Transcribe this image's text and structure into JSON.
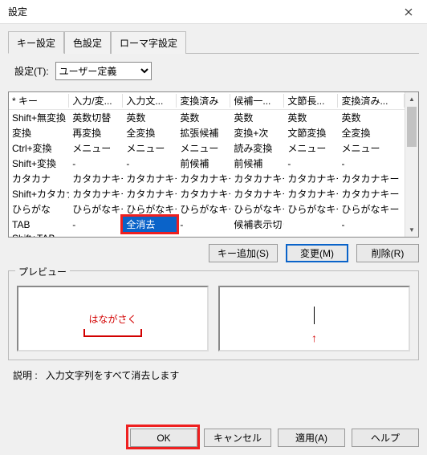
{
  "window": {
    "title": "設定"
  },
  "tabs": [
    {
      "label": "キー設定",
      "active": true
    },
    {
      "label": "色設定"
    },
    {
      "label": "ローマ字設定"
    }
  ],
  "settings": {
    "label": "設定(T):",
    "value": "ユーザー定義"
  },
  "columns": [
    "* キー",
    "入力/変...",
    "入力文...",
    "変換済み",
    "候補一...",
    "文節長...",
    "変換済み..."
  ],
  "rows": [
    [
      "Shift+無変換",
      "英数切替",
      "英数",
      "英数",
      "英数",
      "英数",
      "英数"
    ],
    [
      "変換",
      "再変換",
      "全変換",
      "拡張候補",
      "変換+次",
      "文節変換",
      "全変換"
    ],
    [
      "Ctrl+変換",
      "メニュー",
      "メニュー",
      "メニュー",
      "読み変換",
      "メニュー",
      "メニュー"
    ],
    [
      "Shift+変換",
      "-",
      "-",
      "前候補",
      "前候補",
      "-",
      "-"
    ],
    [
      "カタカナ",
      "カタカナキー",
      "カタカナキー",
      "カタカナキー",
      "カタカナキー",
      "カタカナキー",
      "カタカナキー"
    ],
    [
      "Shift+カタカナ",
      "カタカナキー",
      "カタカナキー",
      "カタカナキー",
      "カタカナキー",
      "カタカナキー",
      "カタカナキー"
    ],
    [
      "ひらがな",
      "ひらがなキー",
      "ひらがなキー",
      "ひらがなキー",
      "ひらがなキー",
      "ひらがなキー",
      "ひらがなキー"
    ],
    [
      "TAB",
      "-",
      "全消去",
      "-",
      "候補表示切り-",
      "",
      "-"
    ],
    [
      "Shift+TAB",
      "-",
      "-",
      "-",
      "-",
      "-",
      "-"
    ]
  ],
  "selected_cell": {
    "row": 7,
    "col": 2
  },
  "buttons": {
    "add": "キー追加(S)",
    "change": "変更(M)",
    "delete": "削除(R)"
  },
  "preview": {
    "legend": "プレビュー",
    "left_text": "はながさく"
  },
  "description": {
    "label": "説明 :",
    "text": "入力文字列をすべて消去します"
  },
  "bottom": {
    "ok": "OK",
    "cancel": "キャンセル",
    "apply": "適用(A)",
    "help": "ヘルプ"
  }
}
